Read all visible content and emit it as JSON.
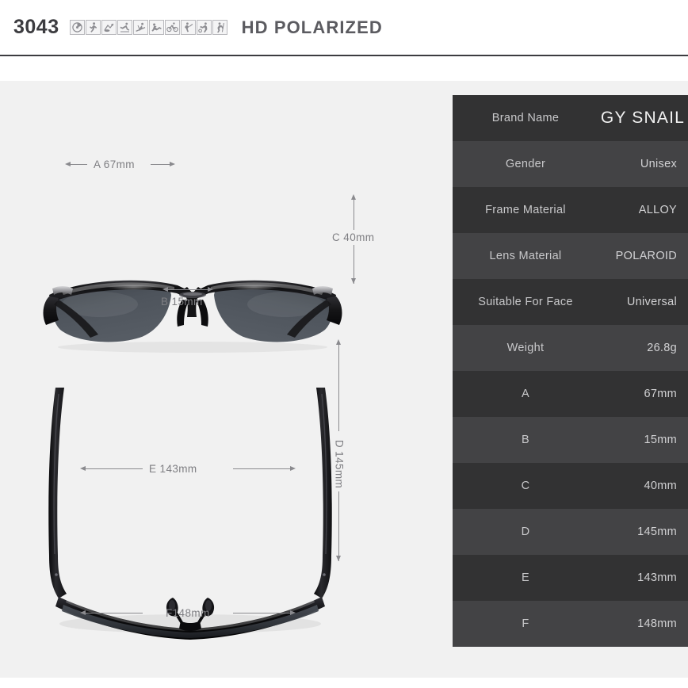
{
  "header": {
    "model_number": "3043",
    "product_type": "HD POLARIZED",
    "sport_icons": [
      "driving-icon",
      "running-icon",
      "fishing-icon",
      "skating-icon",
      "skiing-icon",
      "climbing-icon",
      "cycling-icon",
      "golf-icon",
      "soccer-icon",
      "hiking-icon"
    ]
  },
  "diagram": {
    "front_view": {
      "name": "sunglasses-front-view",
      "dimensions": {
        "a": "A 67mm",
        "b": "B 15mm",
        "c": "C 40mm"
      }
    },
    "top_view": {
      "name": "sunglasses-top-view",
      "dimensions": {
        "d": "D 145mm",
        "e": "E 143mm",
        "f": "F148mm"
      }
    }
  },
  "spec_table": {
    "rows": [
      {
        "label": "Brand Name",
        "value": "GY SNAIL"
      },
      {
        "label": "Gender",
        "value": "Unisex"
      },
      {
        "label": "Frame Material",
        "value": "ALLOY"
      },
      {
        "label": "Lens Material",
        "value": "POLAROID"
      },
      {
        "label": "Suitable For Face",
        "value": "Universal"
      },
      {
        "label": "Weight",
        "value": "26.8g"
      },
      {
        "label": "A",
        "value": "67mm"
      },
      {
        "label": "B",
        "value": "15mm"
      },
      {
        "label": "C",
        "value": "40mm"
      },
      {
        "label": "D",
        "value": "145mm"
      },
      {
        "label": "E",
        "value": "143mm"
      },
      {
        "label": "F",
        "value": "148mm"
      }
    ]
  },
  "colors": {
    "page_background": "#ffffff",
    "content_background": "#f1f1f1",
    "header_text": "#3c3c40",
    "subtitle_text": "#5b5b60",
    "row_dark": "#323233",
    "row_light": "#434345",
    "label_text": "#c8c8ca",
    "value_text": "#d2d2d4",
    "dimension_text": "#7e7e82",
    "arrow": "#8a8a8e",
    "frame_black": "#141416",
    "lens_gray": "#4a4f55"
  }
}
